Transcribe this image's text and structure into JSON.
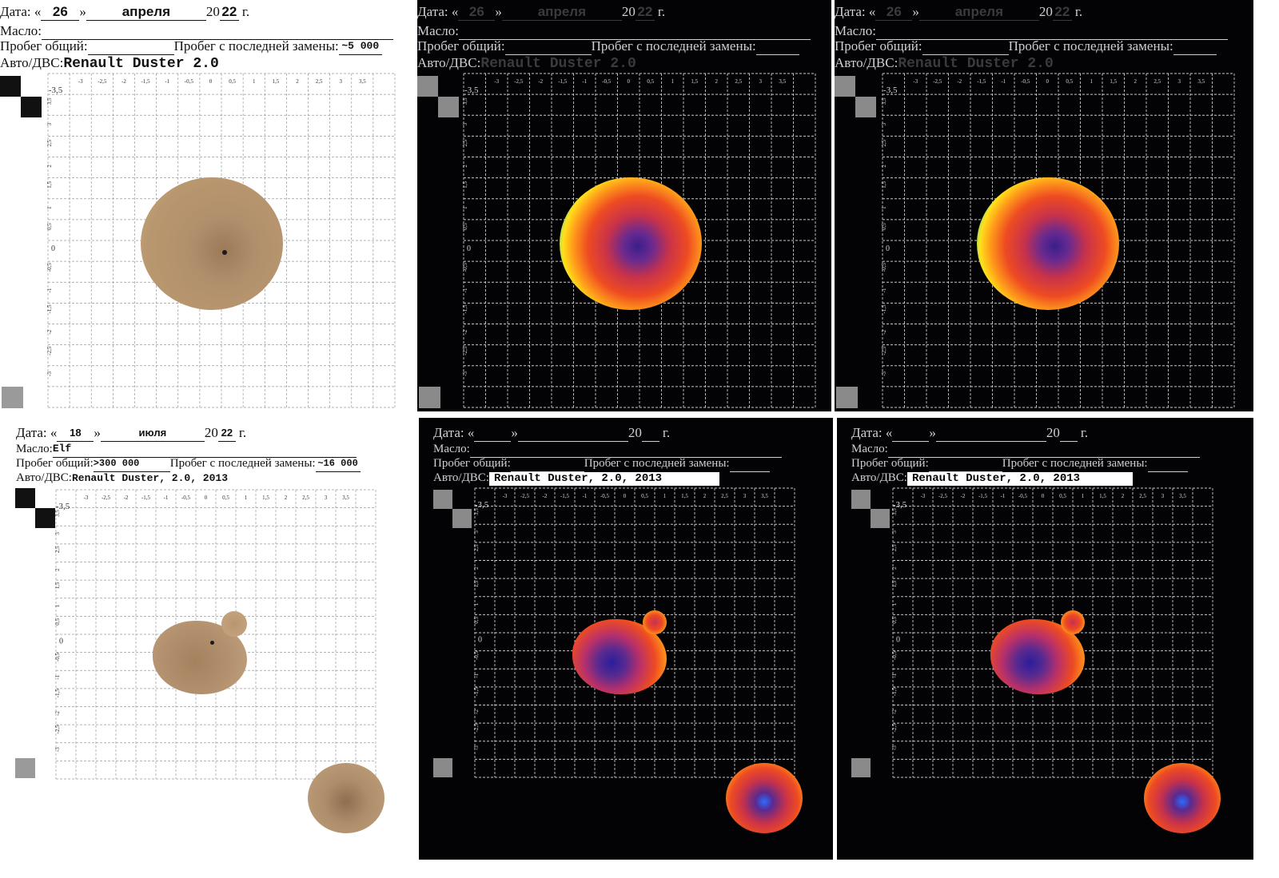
{
  "labels": {
    "date_prefix": "Дата: «",
    "date_close": "»",
    "year_prefix": "20",
    "year_suffix": "г.",
    "oil": "Масло:",
    "mileage_total": "Пробег общий:",
    "mileage_since_change": "Пробег с последней замены:",
    "car_engine": "Авто/ДВС:"
  },
  "axis_ticks": [
    "-3,5",
    "-3",
    "-2,5",
    "-2",
    "-1,5",
    "-1",
    "-0,5",
    "0",
    "0,5",
    "1",
    "1,5",
    "2",
    "2,5",
    "3",
    "3,5"
  ],
  "panels": [
    {
      "id": "april-original",
      "day": "26",
      "month": "апреля",
      "year_suffix": "22",
      "oil": "",
      "mileage_total": "",
      "mileage_since_change": "~5 000",
      "car": "Renault Duster 2.0",
      "style": "light"
    },
    {
      "id": "april-heatmap-1",
      "day": "26",
      "month": "апреля",
      "year_suffix": "22",
      "oil": "",
      "mileage_total": "",
      "mileage_since_change": "",
      "car": "Renault Duster 2.0",
      "style": "dark"
    },
    {
      "id": "april-heatmap-2",
      "day": "26",
      "month": "апреля",
      "year_suffix": "22",
      "oil": "",
      "mileage_total": "",
      "mileage_since_change": "",
      "car": "Renault Duster 2.0",
      "style": "dark"
    },
    {
      "id": "july-original",
      "day": "18",
      "month": "июля",
      "year_suffix": "22",
      "oil": "Elf",
      "mileage_total": ">300 000",
      "mileage_since_change": "~16 000",
      "car": "Renault Duster, 2.0, 2013",
      "style": "light"
    },
    {
      "id": "july-heatmap-1",
      "day": "",
      "month": "",
      "year_suffix": "",
      "oil": "",
      "mileage_total": "",
      "mileage_since_change": "",
      "car": "Renault Duster, 2.0, 2013",
      "style": "dark"
    },
    {
      "id": "july-heatmap-2",
      "day": "",
      "month": "",
      "year_suffix": "",
      "oil": "",
      "mileage_total": "",
      "mileage_since_change": "",
      "car": "Renault Duster, 2.0, 2013",
      "style": "dark"
    }
  ],
  "colors": {
    "paper": "#ffffff",
    "dark_bg": "#030306",
    "oil_stain": "#b49270",
    "heat_core": "#3a1e8a",
    "heat_mid": "#e8452a",
    "heat_edge": "#ffd21a",
    "heat_outer_ring": "#1e6fff"
  }
}
